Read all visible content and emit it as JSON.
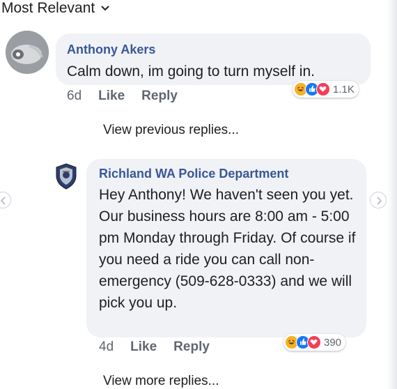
{
  "sort": {
    "label": "Most Relevant",
    "icon": "chevron-down-icon"
  },
  "comments": [
    {
      "author": "Anthony Akers",
      "text": "Calm down, im going to turn myself in.",
      "time": "6d",
      "like_label": "Like",
      "reply_label": "Reply",
      "reactions": {
        "icons": [
          "haha-icon",
          "like-icon",
          "love-icon"
        ],
        "count": "1.1K"
      }
    },
    {
      "author": "Richland WA Police Department",
      "text": "Hey Anthony! We haven't seen you yet. Our business hours are 8:00 am - 5:00 pm Monday through Friday. Of course if you need a ride you can call non-emergency (509-628-0333) and we will pick you up.",
      "time": "4d",
      "like_label": "Like",
      "reply_label": "Reply",
      "reactions": {
        "icons": [
          "haha-icon",
          "like-icon",
          "love-icon"
        ],
        "count": "390"
      }
    }
  ],
  "view_previous": "View previous replies...",
  "view_more": "View more replies...",
  "colors": {
    "author": "#385898",
    "bubble": "#f0f2f5",
    "meta": "#606770",
    "like_blue": "#1877f2",
    "love_red": "#f33e58",
    "haha_yellow": "#f7b125"
  }
}
